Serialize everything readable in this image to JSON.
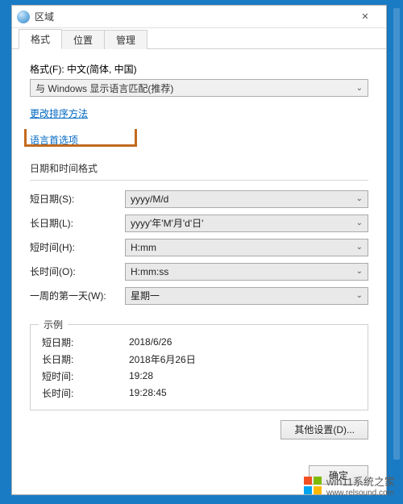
{
  "window": {
    "title": "区域",
    "close_glyph": "✕"
  },
  "tabs": {
    "format": "格式",
    "location": "位置",
    "manage": "管理"
  },
  "body": {
    "format_label": "格式(F): 中文(简体, 中国)",
    "format_selected": "与 Windows 显示语言匹配(推荐)",
    "link_change_sort": "更改排序方法",
    "link_language_pref": "语言首选项",
    "section_date_time": "日期和时间格式",
    "rows": {
      "short_date_label": "短日期(S):",
      "short_date_value": "yyyy/M/d",
      "long_date_label": "长日期(L):",
      "long_date_value": "yyyy'年'M'月'd'日'",
      "short_time_label": "短时间(H):",
      "short_time_value": "H:mm",
      "long_time_label": "长时间(O):",
      "long_time_value": "H:mm:ss",
      "first_day_label": "一周的第一天(W):",
      "first_day_value": "星期一"
    },
    "example_heading": "示例",
    "examples": {
      "short_date_label": "短日期:",
      "short_date_value": "2018/6/26",
      "long_date_label": "长日期:",
      "long_date_value": "2018年6月26日",
      "short_time_label": "短时间:",
      "short_time_value": "19:28",
      "long_time_label": "长时间:",
      "long_time_value": "19:28:45"
    },
    "extra_settings_btn": "其他设置(D)..."
  },
  "buttons": {
    "ok": "确定"
  },
  "watermark": {
    "text": "win11系统之家",
    "url": "www.relsound.com"
  },
  "chevron": "⌄"
}
